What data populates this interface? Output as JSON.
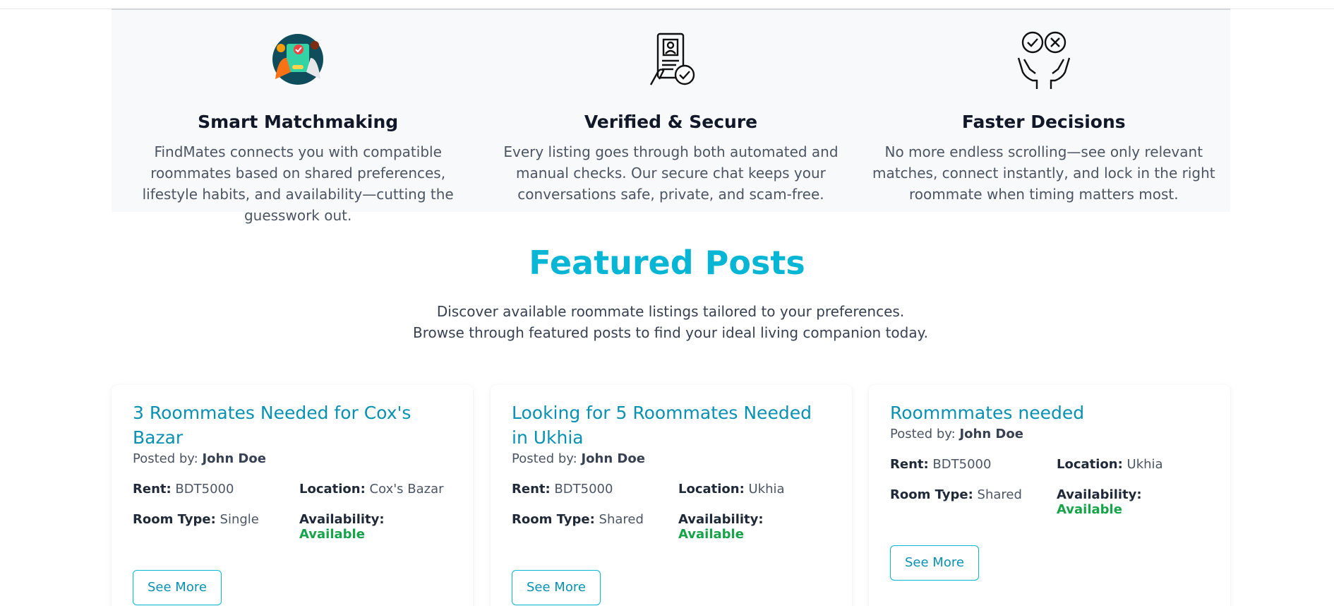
{
  "features": [
    {
      "icon": "matchmaking-icon",
      "title": "Smart Matchmaking",
      "text": "FindMates connects you with compatible roommates based on shared preferences, lifestyle habits, and availability—cutting the guesswork out."
    },
    {
      "icon": "verified-id-icon",
      "title": "Verified & Secure",
      "text": "Every listing goes through both automated and manual checks. Our secure chat keeps your conversations safe, private, and scam-free."
    },
    {
      "icon": "decision-hands-icon",
      "title": "Faster Decisions",
      "text": "No more endless scrolling—see only relevant matches, connect instantly, and lock in the right roommate when timing matters most."
    }
  ],
  "featured": {
    "title": "Featured Posts",
    "subtitle": "Discover available roommate listings tailored to your preferences. Browse through featured posts to find your ideal living companion today."
  },
  "labels": {
    "posted_by": "Posted by:",
    "rent": "Rent:",
    "location": "Location:",
    "room_type": "Room Type:",
    "availability": "Availability:",
    "see_more": "See More"
  },
  "posts": [
    {
      "title": "3 Roommates Needed for Cox's Bazar",
      "author": "John Doe",
      "rent": "BDT5000",
      "location": "Cox's Bazar",
      "room_type": "Single",
      "availability": "Available"
    },
    {
      "title": "Looking for 5 Roommates Needed in Ukhia",
      "author": "John Doe",
      "rent": "BDT5000",
      "location": "Ukhia",
      "room_type": "Shared",
      "availability": "Available"
    },
    {
      "title": "Roommmates needed",
      "author": "John Doe",
      "rent": "BDT5000",
      "location": "Ukhia",
      "room_type": "Shared",
      "availability": "Available"
    }
  ],
  "colors": {
    "accent": "#06b6d4",
    "available": "#16a34a",
    "section_bg": "#f8f9fa"
  }
}
